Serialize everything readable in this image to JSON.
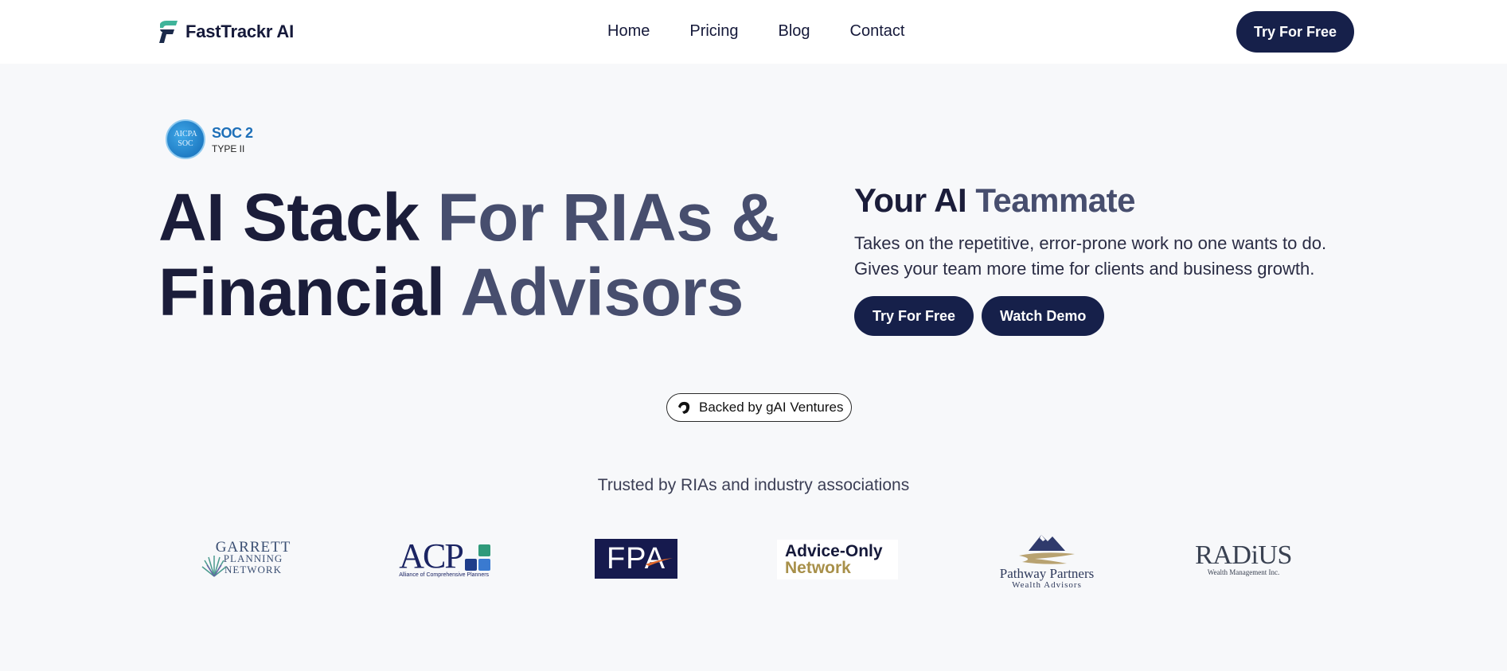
{
  "header": {
    "brand": "FastTrackr AI",
    "nav": [
      "Home",
      "Pricing",
      "Blog",
      "Contact"
    ],
    "cta": "Try For Free"
  },
  "soc_badge": {
    "seal_line1": "AICPA",
    "seal_line2": "SOC",
    "title": "SOC 2",
    "subtitle": "TYPE II"
  },
  "hero": {
    "title_line1_a": "AI Stack",
    "title_line1_b": " For RIAs &",
    "title_line2_a": "Financial",
    "title_line2_b": " Advisors",
    "tagline_a": "Your AI",
    "tagline_b": " Teammate",
    "desc_line1": "Takes on the repetitive, error-prone work no one wants to do.",
    "desc_line2": "Gives your team more time for clients and business growth.",
    "primary_cta": "Try For Free",
    "secondary_cta": "Watch Demo"
  },
  "backed": {
    "label": "Backed by gAI Ventures"
  },
  "trusted": {
    "heading": "Trusted by RIAs and industry associations",
    "logos": {
      "garrett": [
        "GARRETT",
        "PLANNING",
        "NETWORK"
      ],
      "acp": {
        "word": "ACP",
        "sub": "Alliance of Comprehensive Planners"
      },
      "fpa": {
        "word": "FPA"
      },
      "advice": [
        "Advice-Only",
        "Network"
      ],
      "pathway": [
        "Pathway Partners",
        "Wealth Advisors"
      ],
      "radius": [
        "RADiUS",
        "Wealth Management Inc."
      ]
    }
  },
  "colors": {
    "navy": "#16204a",
    "title_dark": "#1b1d3a",
    "title_mid": "#474e6e",
    "gold": "#a8904a",
    "background": "#f7f8fa"
  }
}
